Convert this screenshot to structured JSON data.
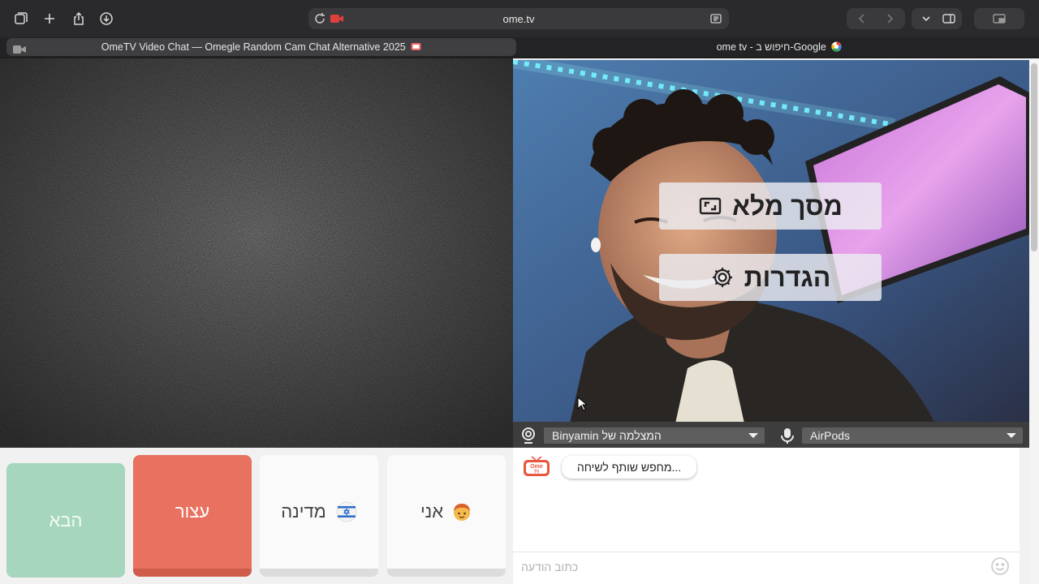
{
  "browser": {
    "url": "ome.tv",
    "tabs": [
      {
        "title": "OmeTV Video Chat — Omegle Random Cam Chat Alternative 2025"
      },
      {
        "title": "ome tv - חיפוש ב-Google"
      }
    ],
    "toolbar_icons": [
      "sidebar-tabs-icon",
      "new-tab-icon",
      "share-icon",
      "downloads-icon",
      "reload-icon",
      "camera-recording-icon",
      "reader-icon",
      "back-icon",
      "forward-icon",
      "dropdown-icon",
      "sidebar-icon",
      "picture-in-picture-icon"
    ]
  },
  "video": {
    "fullscreen_label": "מסך מלא",
    "settings_label": "הגדרות",
    "camera_select": "Binyamin המצלמה של",
    "mic_select": "AirPods"
  },
  "controls": {
    "next_label": "הבא",
    "stop_label": "עצור",
    "country_label": "מדינה",
    "me_label": "אני",
    "country_flag": "israel-flag-icon",
    "me_emoji": "boy-emoji-icon"
  },
  "chat": {
    "status_message": "מחפש שותף לשיחה...",
    "input_placeholder": "כתוב הודעה",
    "logo_text_top": "Ome",
    "logo_text_bottom": "TV"
  },
  "colors": {
    "next": "#a6d6bd",
    "stop": "#e8715f",
    "device_bar": "#3d3d3d"
  }
}
